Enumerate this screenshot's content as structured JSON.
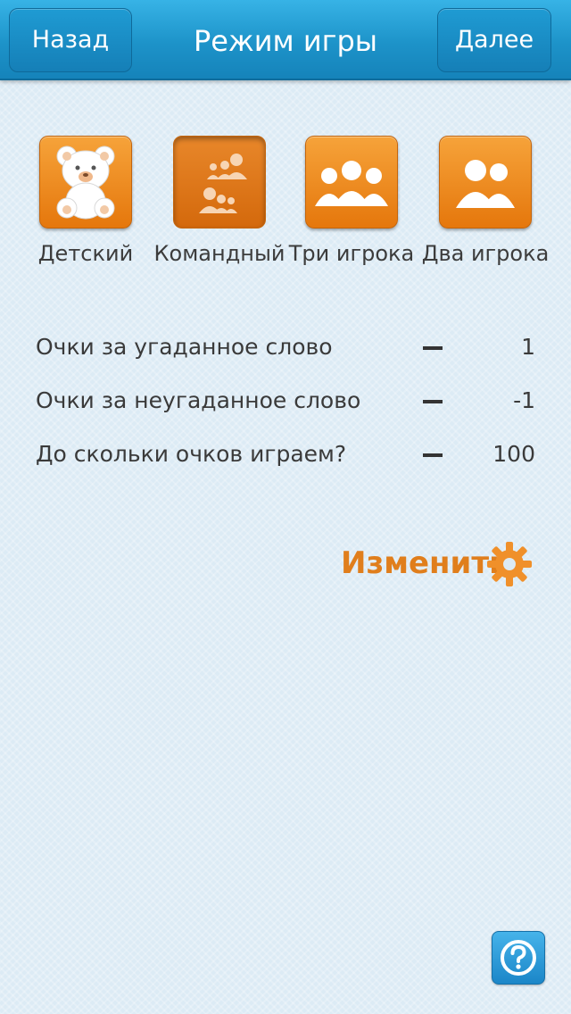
{
  "navbar": {
    "back_label": "Назад",
    "title": "Режим игры",
    "next_label": "Далее"
  },
  "modes": [
    {
      "label": "Детский",
      "icon": "teddy-bear-icon",
      "selected": false
    },
    {
      "label": "Командный",
      "icon": "teams-icon",
      "selected": true
    },
    {
      "label": "Три игрока",
      "icon": "three-players-icon",
      "selected": false
    },
    {
      "label": "Два игрока",
      "icon": "two-players-icon",
      "selected": false
    }
  ],
  "settings": [
    {
      "label": "Очки за угаданное слово",
      "value": "1"
    },
    {
      "label": "Очки за неугаданное слово",
      "value": "-1"
    },
    {
      "label": "До скольки очков играем?",
      "value": "100"
    }
  ],
  "change": {
    "label": "Изменить",
    "icon": "gear-icon"
  },
  "help": {
    "icon": "help-icon"
  },
  "colors": {
    "accent": "#e07e1c",
    "navbar": "#1d93c9",
    "mode_orange": "#f0902a"
  }
}
